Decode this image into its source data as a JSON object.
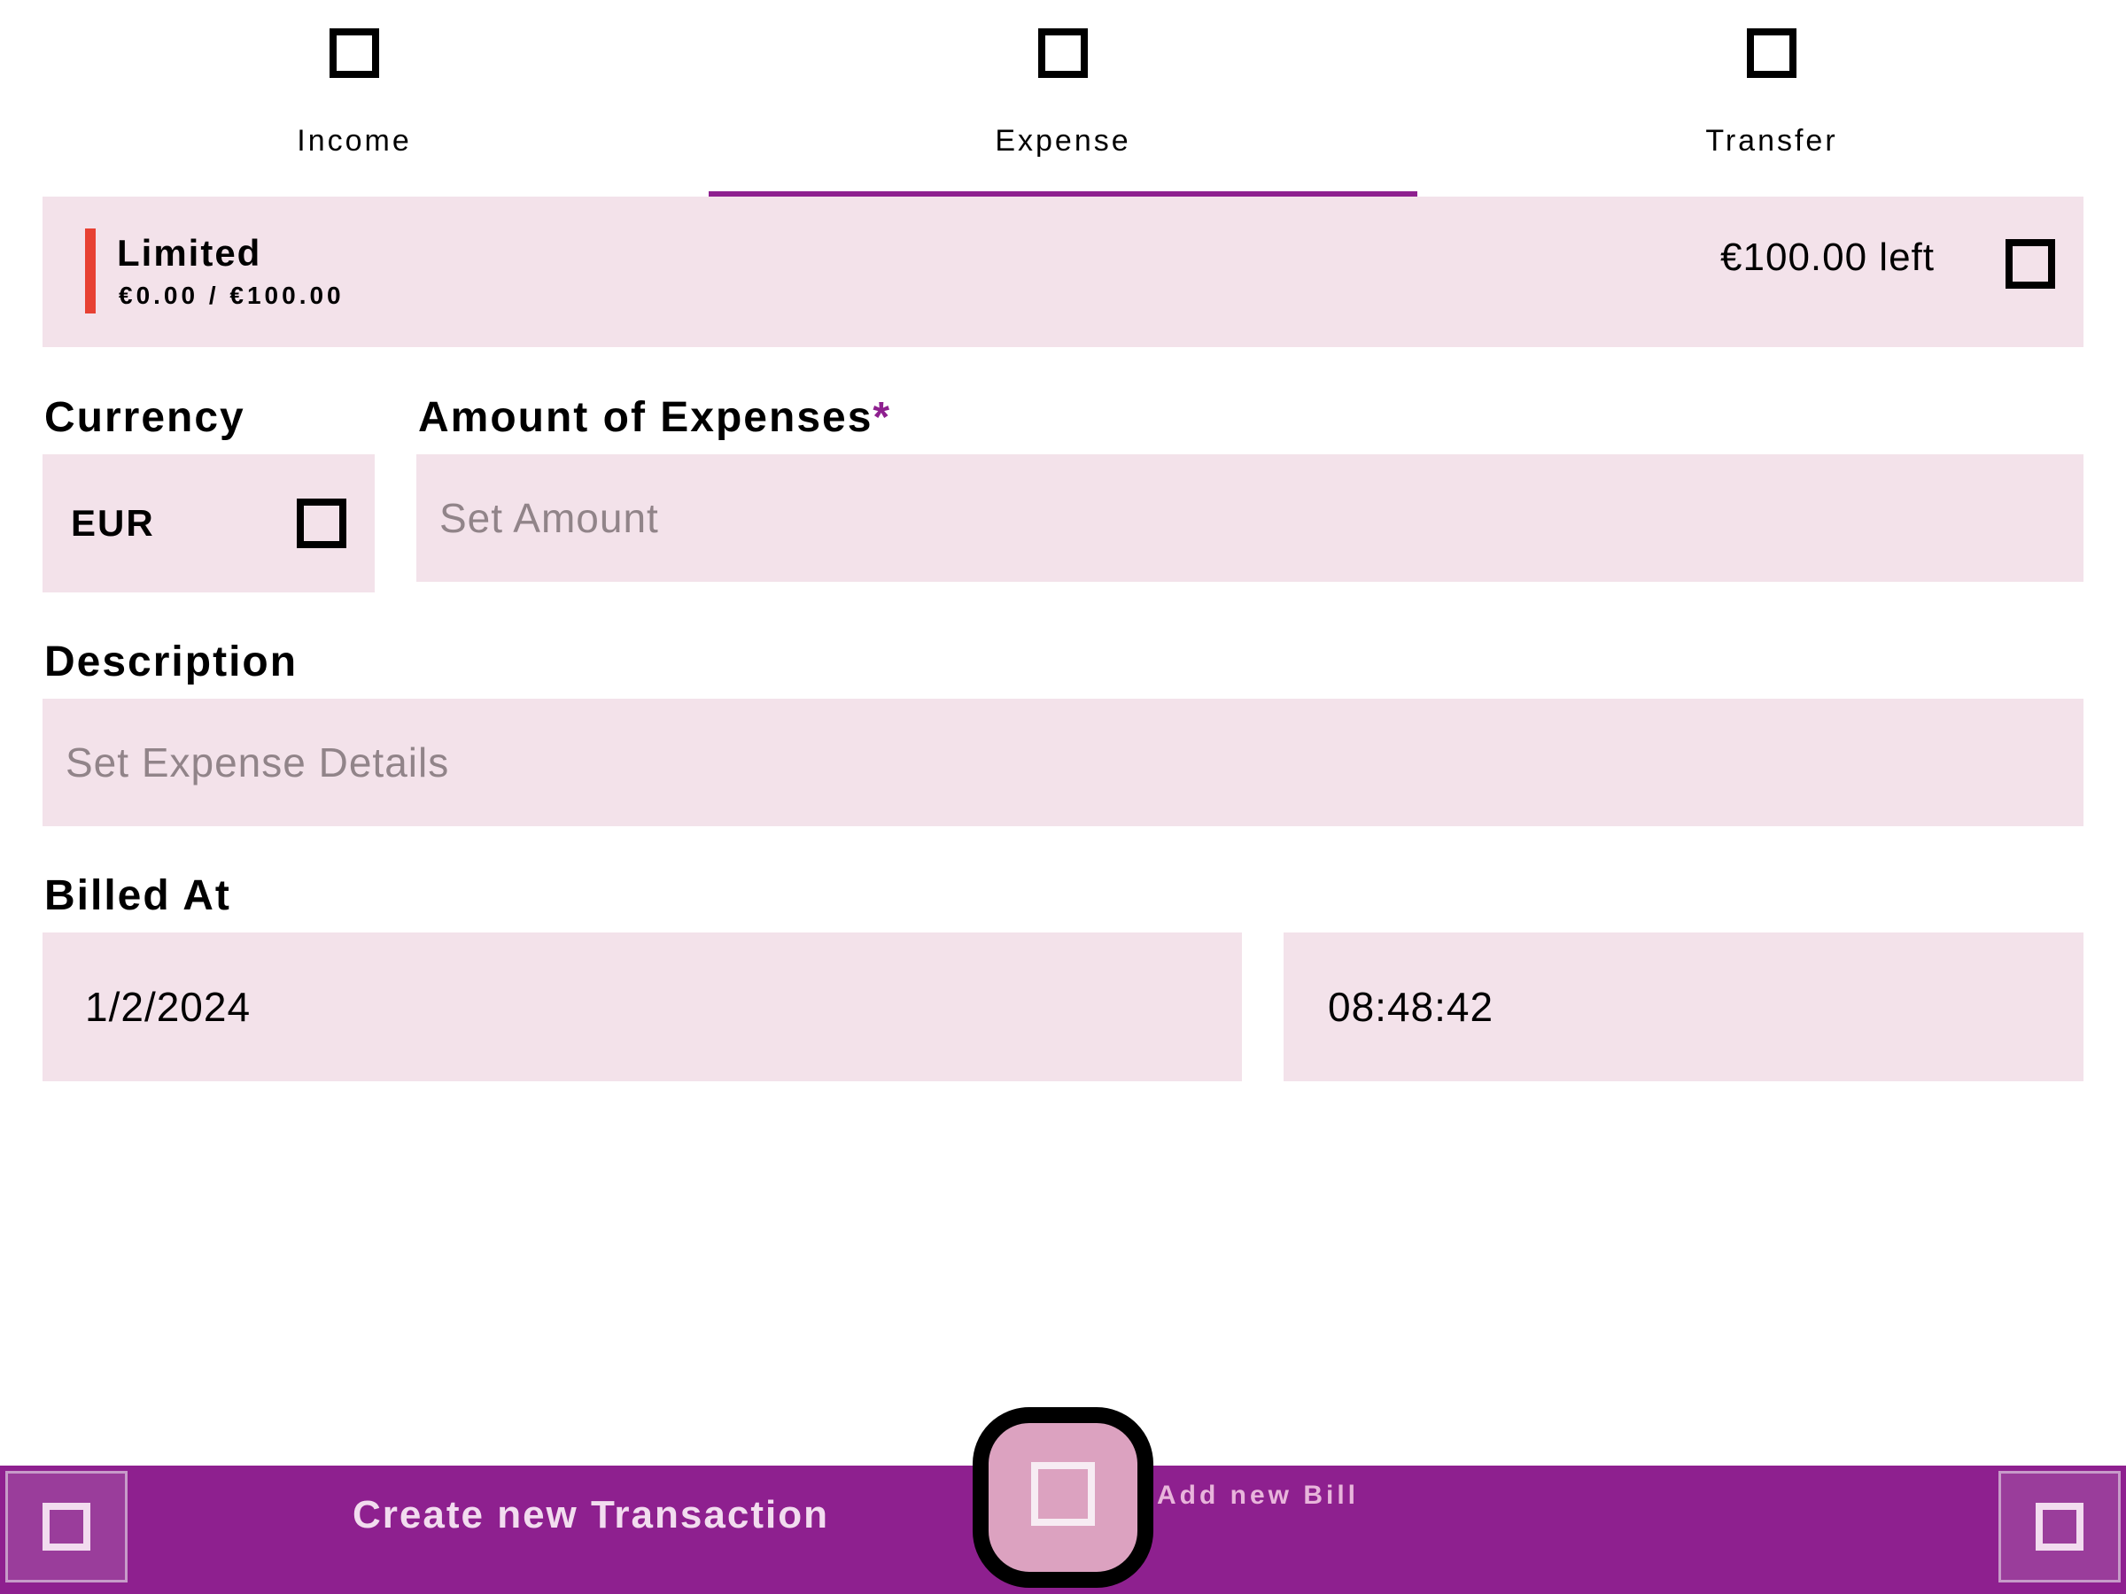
{
  "colors": {
    "accent": "#8e208f",
    "field_background": "#f3e2ea",
    "budget_indicator": "#e74133",
    "bottom_bar": "#8e208f",
    "fab_background": "#dca2c0"
  },
  "tabs": [
    {
      "label": "Income",
      "icon": "square-icon",
      "selected": false
    },
    {
      "label": "Expense",
      "icon": "square-icon",
      "selected": true
    },
    {
      "label": "Transfer",
      "icon": "square-icon",
      "selected": false
    }
  ],
  "budget": {
    "name": "Limited",
    "range": "€0.00 / €100.00",
    "left": "€100.00 left",
    "icon": "square-icon"
  },
  "currency": {
    "label": "Currency",
    "value": "EUR",
    "icon": "square-icon"
  },
  "amount": {
    "label": "Amount of Expenses",
    "required_mark": "*",
    "placeholder": "Set Amount",
    "value": ""
  },
  "description": {
    "label": "Description",
    "placeholder": "Set Expense Details",
    "value": ""
  },
  "billed_at": {
    "label": "Billed At",
    "date": "1/2/2024",
    "time": "08:48:42"
  },
  "bottom_bar": {
    "title": "Create new Transaction",
    "fab_label": "Add new Bill",
    "left_icon": "square-icon",
    "right_icon": "square-icon",
    "fab_icon": "square-icon"
  }
}
